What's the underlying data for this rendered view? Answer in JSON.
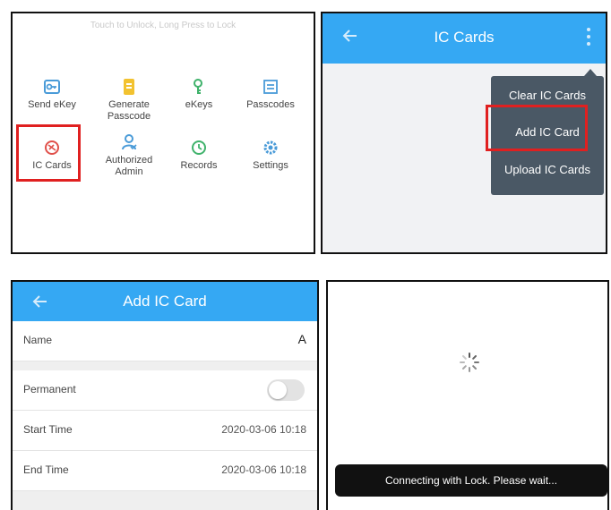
{
  "panel1": {
    "hint": "Touch to Unlock, Long Press to Lock",
    "items": [
      {
        "label": "Send eKey",
        "icon": "send-ekey-icon"
      },
      {
        "label": "Generate Passcode",
        "icon": "generate-passcode-icon"
      },
      {
        "label": "eKeys",
        "icon": "ekeys-icon"
      },
      {
        "label": "Passcodes",
        "icon": "passcodes-icon"
      },
      {
        "label": "IC Cards",
        "icon": "ic-cards-icon"
      },
      {
        "label": "Authorized Admin",
        "icon": "authorized-admin-icon"
      },
      {
        "label": "Records",
        "icon": "records-icon"
      },
      {
        "label": "Settings",
        "icon": "settings-icon"
      }
    ]
  },
  "panel2": {
    "title": "IC Cards",
    "menu": [
      "Clear IC Cards",
      "Add IC Card",
      "Upload IC Cards"
    ]
  },
  "panel3": {
    "title": "Add IC Card",
    "rows": [
      {
        "label": "Name",
        "value": "A"
      },
      {
        "label": "Permanent",
        "value": ""
      },
      {
        "label": "Start Time",
        "value": "2020-03-06 10:18"
      },
      {
        "label": "End Time",
        "value": "2020-03-06 10:18"
      }
    ],
    "permanent_on": false
  },
  "panel4": {
    "toast": "Connecting with Lock. Please wait..."
  },
  "colors": {
    "accent": "#35a8f3",
    "highlight": "#e02020",
    "menu_bg": "#4a5865",
    "icon_blue": "#4a9bd8",
    "icon_yellow": "#f2c230",
    "icon_green": "#3fb26b",
    "icon_red": "#e0504a"
  }
}
